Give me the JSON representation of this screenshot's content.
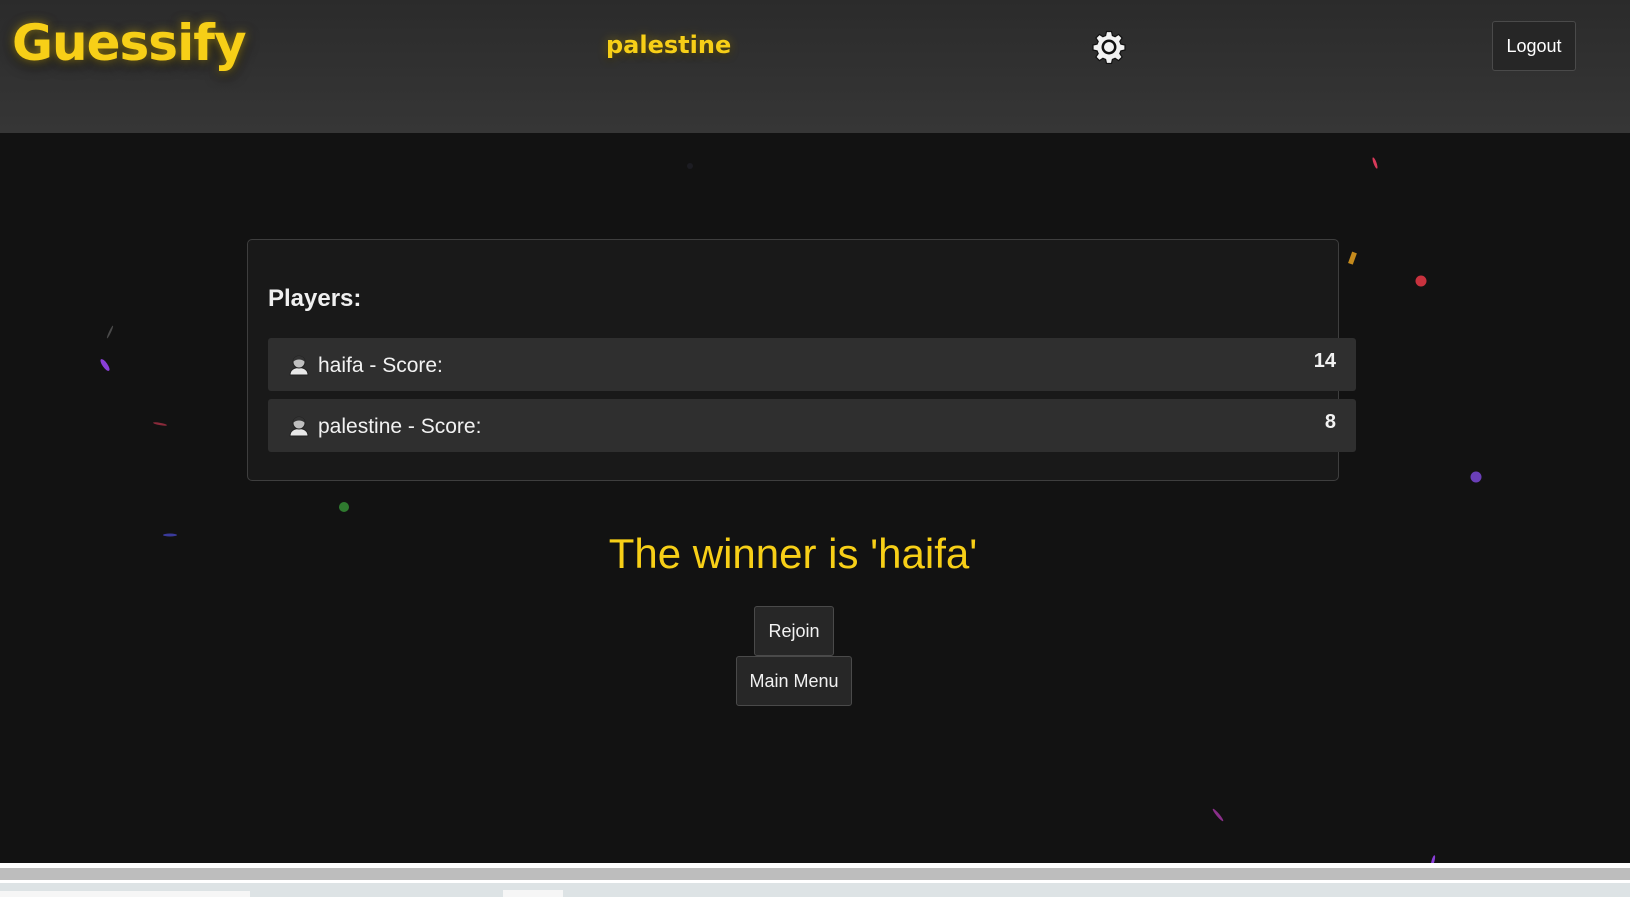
{
  "header": {
    "logo": "Guessify",
    "username": "palestine",
    "logout_label": "Logout"
  },
  "players": {
    "title": "Players:",
    "list": [
      {
        "name": "haifa - Score:",
        "score": "14"
      },
      {
        "name": "palestine - Score:",
        "score": "8"
      }
    ]
  },
  "result": {
    "winner_text": "The winner is 'haifa'",
    "rejoin_label": "Rejoin",
    "main_menu_label": "Main Menu"
  },
  "colors": {
    "accent": "#f7cf17",
    "background": "#121212",
    "header_bg": "#333333",
    "row_bg": "#2f2f2f"
  },
  "icons": {
    "settings": "gear-icon",
    "player": "user-avatar-icon"
  }
}
